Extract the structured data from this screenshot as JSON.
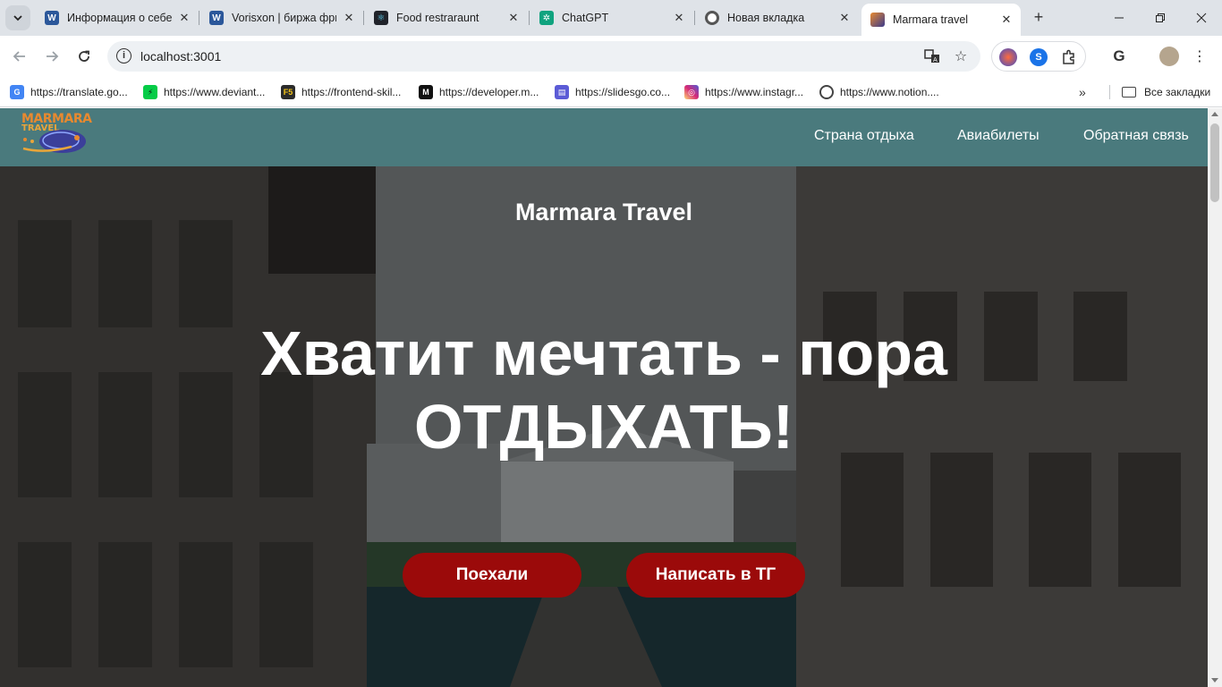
{
  "tabs": [
    {
      "title": "Информация о себе",
      "icon": "word-icon"
    },
    {
      "title": "Vorisxon | биржа фри",
      "icon": "word-icon"
    },
    {
      "title": "Food restraraunt",
      "icon": "react-icon"
    },
    {
      "title": "ChatGPT",
      "icon": "chatgpt-icon"
    },
    {
      "title": "Новая вкладка",
      "icon": "chrome-icon"
    },
    {
      "title": "Marmara travel",
      "icon": "marmara-icon",
      "active": true
    }
  ],
  "address": {
    "url": "localhost:3001"
  },
  "bookmarks": [
    {
      "label": "https://translate.go..."
    },
    {
      "label": "https://www.deviant..."
    },
    {
      "label": "https://frontend-skil..."
    },
    {
      "label": "https://developer.m..."
    },
    {
      "label": "https://slidesgo.co..."
    },
    {
      "label": "https://www.instagr..."
    },
    {
      "label": "https://www.notion...."
    }
  ],
  "bookmarks_all": "Все закладки",
  "site": {
    "logo_line1": "MARMARA",
    "logo_line2": "TRAVEL",
    "nav": [
      "Страна отдыха",
      "Авиабилеты",
      "Обратная связь"
    ],
    "hero_title": "Marmara Travel",
    "hero_line1": "Хватит мечтать - пора",
    "hero_line2": "ОТДЫХАТЬ!",
    "btn_go": "Поехали",
    "btn_tg": "Написать в ТГ"
  },
  "colors": {
    "header_bg": "#4a7a7d",
    "button_bg": "#9b0a0a",
    "tabstrip_bg": "#dfe3e8"
  }
}
